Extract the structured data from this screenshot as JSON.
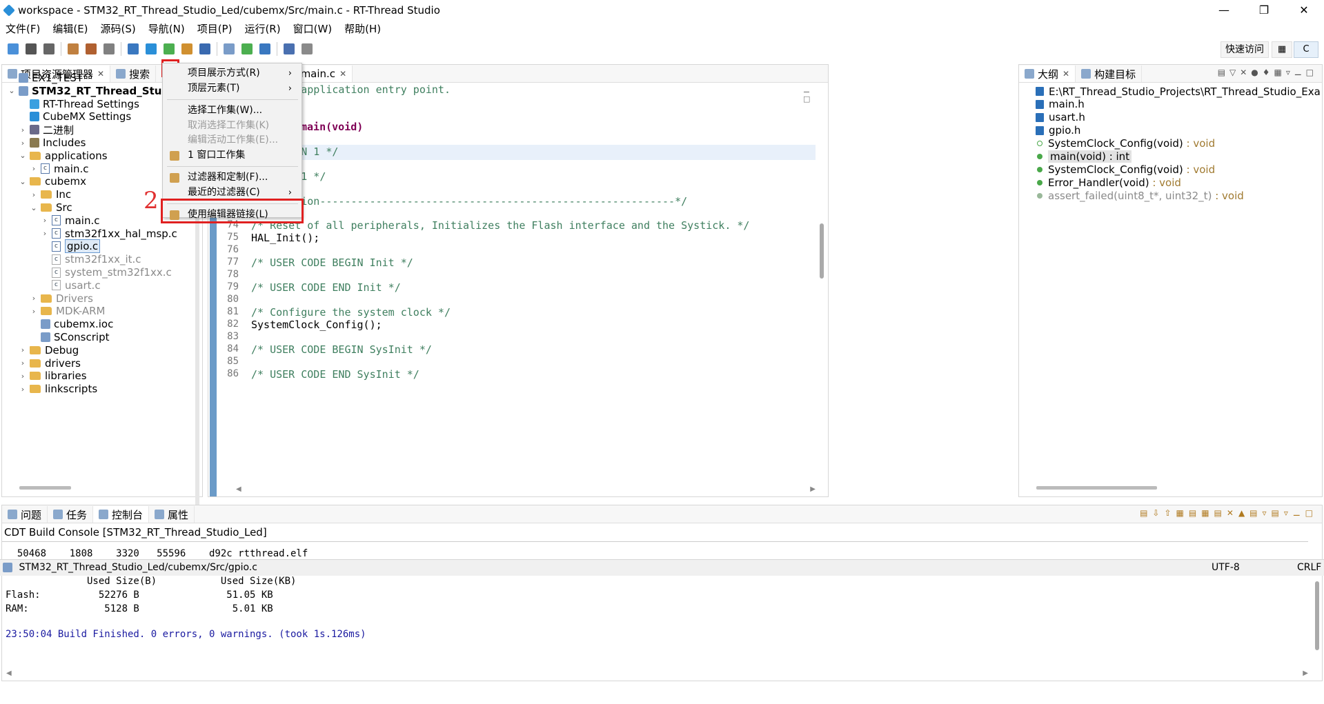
{
  "window": {
    "title": "workspace - STM32_RT_Thread_Studio_Led/cubemx/Src/main.c - RT-Thread Studio"
  },
  "menubar": [
    "文件(F)",
    "编辑(E)",
    "源码(S)",
    "导航(N)",
    "项目(P)",
    "运行(R)",
    "窗口(W)",
    "帮助(H)"
  ],
  "toolbar": {
    "quick_access": "快速访问",
    "perspective": "C"
  },
  "left_panel": {
    "tabs": [
      {
        "label": "项目资源管理器"
      },
      {
        "label": "搜索"
      }
    ],
    "tree": [
      {
        "label": "EX1_TEST",
        "indent": 0,
        "caret": "",
        "icon": "project",
        "bold": false,
        "grey": false
      },
      {
        "label": "STM32_RT_Thread_Studio_Led",
        "indent": 0,
        "caret": "v",
        "icon": "project",
        "bold": true,
        "grey": false
      },
      {
        "label": "RT-Thread Settings",
        "indent": 1,
        "caret": "",
        "icon": "rt",
        "bold": false,
        "grey": false
      },
      {
        "label": "CubeMX Settings",
        "indent": 1,
        "caret": "",
        "icon": "mx",
        "bold": false,
        "grey": false
      },
      {
        "label": "二进制",
        "indent": 1,
        "caret": ">",
        "icon": "binary",
        "bold": false,
        "grey": false
      },
      {
        "label": "Includes",
        "indent": 1,
        "caret": ">",
        "icon": "includes",
        "bold": false,
        "grey": false
      },
      {
        "label": "applications",
        "indent": 1,
        "caret": "v",
        "icon": "folder",
        "bold": false,
        "grey": false
      },
      {
        "label": "main.c",
        "indent": 2,
        "caret": ">",
        "icon": "c",
        "bold": false,
        "grey": false
      },
      {
        "label": "cubemx",
        "indent": 1,
        "caret": "v",
        "icon": "folder",
        "bold": false,
        "grey": false
      },
      {
        "label": "Inc",
        "indent": 2,
        "caret": ">",
        "icon": "folder",
        "bold": false,
        "grey": false
      },
      {
        "label": "Src",
        "indent": 2,
        "caret": "v",
        "icon": "folder",
        "bold": false,
        "grey": false
      },
      {
        "label": "main.c",
        "indent": 3,
        "caret": ">",
        "icon": "c",
        "bold": false,
        "grey": false
      },
      {
        "label": "stm32f1xx_hal_msp.c",
        "indent": 3,
        "caret": ">",
        "icon": "c",
        "bold": false,
        "grey": false
      },
      {
        "label": "gpio.c",
        "indent": 3,
        "caret": "",
        "icon": "cx",
        "bold": false,
        "grey": false,
        "selected": true
      },
      {
        "label": "stm32f1xx_it.c",
        "indent": 3,
        "caret": "",
        "icon": "cx",
        "bold": false,
        "grey": true
      },
      {
        "label": "system_stm32f1xx.c",
        "indent": 3,
        "caret": "",
        "icon": "cx",
        "bold": false,
        "grey": true
      },
      {
        "label": "usart.c",
        "indent": 3,
        "caret": "",
        "icon": "cx",
        "bold": false,
        "grey": true
      },
      {
        "label": "Drivers",
        "indent": 2,
        "caret": ">",
        "icon": "folder",
        "bold": false,
        "grey": true
      },
      {
        "label": "MDK-ARM",
        "indent": 2,
        "caret": ">",
        "icon": "folder",
        "bold": false,
        "grey": true
      },
      {
        "label": "cubemx.ioc",
        "indent": 2,
        "caret": "",
        "icon": "file",
        "bold": false,
        "grey": false
      },
      {
        "label": "SConscript",
        "indent": 2,
        "caret": "",
        "icon": "file",
        "bold": false,
        "grey": false
      },
      {
        "label": "Debug",
        "indent": 1,
        "caret": ">",
        "icon": "folder",
        "bold": false,
        "grey": false
      },
      {
        "label": "drivers",
        "indent": 1,
        "caret": ">",
        "icon": "folder",
        "bold": false,
        "grey": false
      },
      {
        "label": "libraries",
        "indent": 1,
        "caret": ">",
        "icon": "folder",
        "bold": false,
        "grey": false
      },
      {
        "label": "linkscripts",
        "indent": 1,
        "caret": ">",
        "icon": "folder",
        "bold": false,
        "grey": false
      }
    ],
    "annotation": "2"
  },
  "context_menu": {
    "items": [
      {
        "label": "项目展示方式(R)",
        "arrow": "›",
        "disabled": false
      },
      {
        "label": "顶层元素(T)",
        "arrow": "›",
        "disabled": false
      },
      {
        "sep": true
      },
      {
        "label": "选择工作集(W)...",
        "arrow": "",
        "disabled": false
      },
      {
        "label": "取消选择工作集(K)",
        "arrow": "",
        "disabled": true
      },
      {
        "label": "编辑活动工作集(E)...",
        "arrow": "",
        "disabled": true
      },
      {
        "label": "1 窗口工作集",
        "arrow": "",
        "disabled": false
      },
      {
        "sep": true
      },
      {
        "label": "过滤器和定制(F)...",
        "arrow": "",
        "disabled": false,
        "highlight": true
      },
      {
        "label": "最近的过滤器(C)",
        "arrow": "›",
        "disabled": false
      },
      {
        "sep": true
      },
      {
        "label": "使用编辑器链接(L)",
        "arrow": "",
        "disabled": false
      }
    ]
  },
  "editor": {
    "tabs": [
      {
        "label": "main.c",
        "active": false
      },
      {
        "label": "main.c",
        "active": true
      }
    ],
    "lines": [
      {
        "n": "",
        "t": "    The application entry point.",
        "cls": "cmt"
      },
      {
        "n": "",
        "t": "    int",
        "cls": "cmt"
      },
      {
        "n": "",
        "t": "",
        "cls": ""
      },
      {
        "n": "",
        "t": "main(void)",
        "cls": "main"
      },
      {
        "n": "",
        "t": "",
        "cls": ""
      },
      {
        "n": "",
        "t": "ODE BEGIN 1 */",
        "cls": "cmt"
      },
      {
        "n": "",
        "t": "",
        "cls": ""
      },
      {
        "n": "",
        "t": "ODE END 1 */",
        "cls": "cmt"
      },
      {
        "n": "",
        "t": "",
        "cls": ""
      },
      {
        "n": "",
        "t": "nfiguration---------------------------------------------------------*/",
        "cls": "cmt"
      },
      {
        "n": "73",
        "t": "",
        "cls": ""
      },
      {
        "n": "74",
        "t": "/* Reset of all peripherals, Initializes the Flash interface and the Systick. */",
        "cls": "cmt"
      },
      {
        "n": "75",
        "t": "HAL_Init();",
        "cls": ""
      },
      {
        "n": "76",
        "t": "",
        "cls": ""
      },
      {
        "n": "77",
        "t": "/* USER CODE BEGIN Init */",
        "cls": "cmt"
      },
      {
        "n": "78",
        "t": "",
        "cls": ""
      },
      {
        "n": "79",
        "t": "/* USER CODE END Init */",
        "cls": "cmt"
      },
      {
        "n": "80",
        "t": "",
        "cls": ""
      },
      {
        "n": "81",
        "t": "/* Configure the system clock */",
        "cls": "cmt"
      },
      {
        "n": "82",
        "t": "SystemClock_Config();",
        "cls": ""
      },
      {
        "n": "83",
        "t": "",
        "cls": ""
      },
      {
        "n": "84",
        "t": "/* USER CODE BEGIN SysInit */",
        "cls": "cmt"
      },
      {
        "n": "85",
        "t": "",
        "cls": ""
      },
      {
        "n": "86",
        "t": "/* USER CODE END SysInit */",
        "cls": "cmt"
      }
    ]
  },
  "outline": {
    "tabs": [
      {
        "label": "大纲"
      },
      {
        "label": "构建目标"
      }
    ],
    "items": [
      {
        "label": "E:\\RT_Thread_Studio_Projects\\RT_Thread_Studio_Exa",
        "type": "",
        "icon": "include",
        "grey": false
      },
      {
        "label": "main.h",
        "type": "",
        "icon": "include",
        "grey": false
      },
      {
        "label": "usart.h",
        "type": "",
        "icon": "include",
        "grey": false
      },
      {
        "label": "gpio.h",
        "type": "",
        "icon": "include",
        "grey": false
      },
      {
        "label": "SystemClock_Config(void)",
        "type": " : void",
        "icon": "decl",
        "grey": false
      },
      {
        "label": "main(void) : int",
        "type": "",
        "icon": "fn",
        "grey": false,
        "selected": true
      },
      {
        "label": "SystemClock_Config(void)",
        "type": " : void",
        "icon": "fn",
        "grey": false
      },
      {
        "label": "Error_Handler(void)",
        "type": " : void",
        "icon": "fn",
        "grey": false
      },
      {
        "label": "assert_failed(uint8_t*, uint32_t)",
        "type": " : void",
        "icon": "fn",
        "grey": true
      }
    ]
  },
  "bottom": {
    "tabs": [
      {
        "label": "问题"
      },
      {
        "label": "任务"
      },
      {
        "label": "控制台",
        "active": true
      },
      {
        "label": "属性"
      }
    ],
    "console_title": "CDT Build Console [STM32_RT_Thread_Studio_Led]",
    "console_lines": [
      "  50468    1808    3320   55596    d92c rtthread.elf",
      "",
      "              Used Size(B)           Used Size(KB)",
      "Flash:          52276 B               51.05 KB",
      "RAM:             5128 B                5.01 KB",
      ""
    ],
    "build_finished": "23:50:04 Build Finished. 0 errors, 0 warnings. (took 1s.126ms)"
  },
  "status": {
    "path": "STM32_RT_Thread_Studio_Led/cubemx/Src/gpio.c",
    "encoding": "UTF-8",
    "eol": "CRLF"
  },
  "colors": {
    "comment": "#3f7f5f",
    "keyword": "#7f0055",
    "highlight": "#e02020",
    "console_blue": "#1a1aa0"
  }
}
